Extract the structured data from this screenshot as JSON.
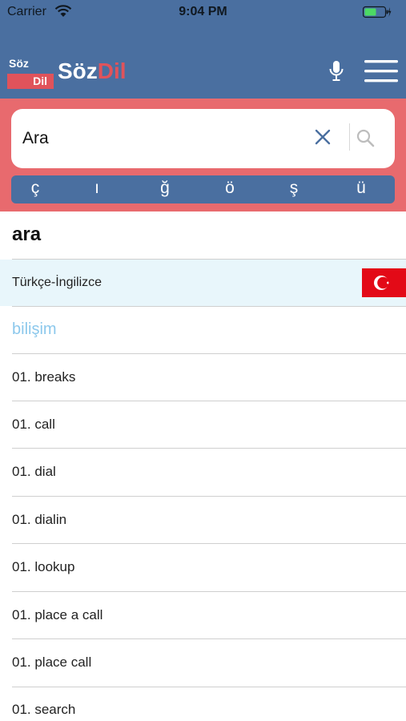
{
  "status_bar": {
    "carrier": "Carrier",
    "time": "9:04 PM",
    "battery_color": "#4cd964"
  },
  "header": {
    "badge_line1": "Söz",
    "badge_line2": "Dil",
    "wordmark_part1": "Söz",
    "wordmark_part2": "Dil",
    "brand_blue": "#4a6fa0",
    "brand_red": "#e0535b",
    "icons": [
      "microphone-icon",
      "hamburger-menu-icon"
    ]
  },
  "search": {
    "query": "Ara",
    "icons": [
      "close-icon",
      "search-icon"
    ],
    "special_letters": [
      "ç",
      "ı",
      "ğ",
      "ö",
      "ş",
      "ü"
    ]
  },
  "result": {
    "headword": "ara",
    "language_pair": "Türkçe-İngilizce",
    "flag_icon": "turkey-flag-icon",
    "category": "bilişim",
    "translations": [
      "01. breaks",
      "01. call",
      "01. dial",
      "01. dialin",
      "01. lookup",
      "01. place a call",
      "01. place call",
      "01. search"
    ]
  }
}
